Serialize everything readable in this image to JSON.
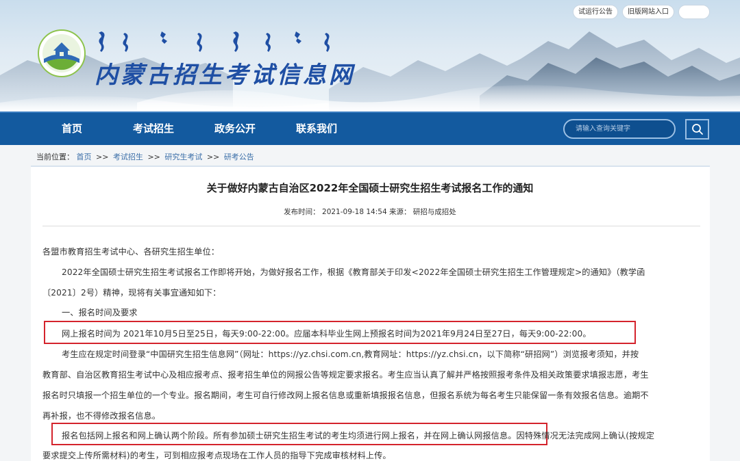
{
  "header": {
    "top_links": [
      "试运行公告",
      "旧版网站入口"
    ],
    "site_title": "内蒙古招生考试信息网"
  },
  "nav": {
    "items": [
      "首页",
      "考试招生",
      "政务公开",
      "联系我们"
    ],
    "search_placeholder": "请输入查询关键字"
  },
  "breadcrumb": {
    "label": "当前位置：",
    "crumbs": [
      "首页",
      "考试招生",
      "研究生考试",
      "研考公告"
    ],
    "separator": ">>"
  },
  "article": {
    "title": "关于做好内蒙古自治区2022年全国硕士研究生招生考试报名工作的通知",
    "meta": "发布时间： 2021-09-18 14:54 来源： 研招与成招处",
    "lines": [
      "各盟市教育招生考试中心、各研究生招生单位：",
      "2022年全国硕士研究生招生考试报名工作即将开始，为做好报名工作，根据《教育部关于印发<2022年全国硕士研究生招生工作管理规定>的通知》（教学函",
      "〔2021〕2号）精神，现将有关事宜通知如下：",
      "一、报名时间及要求",
      "网上报名时间为 2021年10月5日至25日，每天9:00-22:00。应届本科毕业生网上预报名时间为2021年9月24日至27日，每天9:00-22:00。",
      "考生应在规定时间登录“中国研究生招生信息网”（网址：https://yz.chsi.com.cn,教育网址：https://yz.chsi.cn，以下简称“研招网”）浏览报考须知，并按",
      "教育部、自治区教育招生考试中心及相应报考点、报考招生单位的网报公告等规定要求报名。考生应当认真了解并严格按照报考条件及相关政策要求填报志愿，考生",
      "报名时只填报一个招生单位的一个专业。报名期间，考生可自行修改网上报名信息或重新填报报名信息，但报名系统为每名考生只能保留一条有效报名信息。逾期不",
      "再补报，也不得修改报名信息。",
      "报名包括网上报名和网上确认两个阶段。所有参加硕士研究生招生考试的考生均须进行网上报名，并在网上确认网报信息。因特殊情况无法完成网上确认(按规定",
      "要求提交上传所需材料)的考生，可到相应报考点现场在工作人员的指导下完成审核材料上传。"
    ]
  }
}
